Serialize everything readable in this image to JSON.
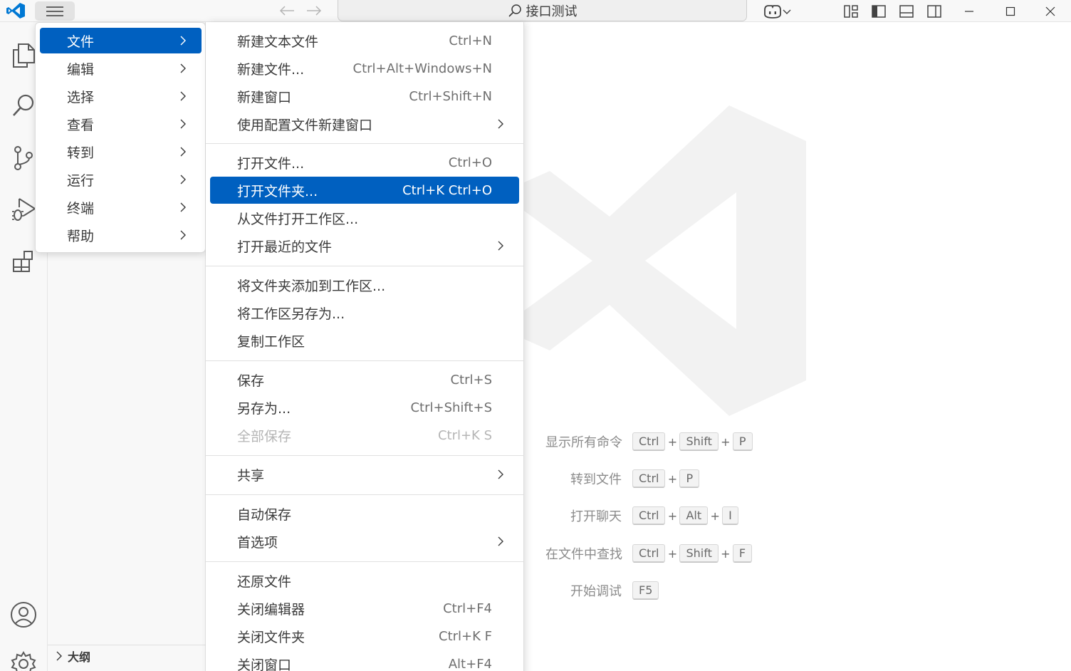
{
  "titlebar": {
    "search_text": "接口测试"
  },
  "main_menu": {
    "items": [
      {
        "label": "文件",
        "active": true
      },
      {
        "label": "编辑"
      },
      {
        "label": "选择"
      },
      {
        "label": "查看"
      },
      {
        "label": "转到"
      },
      {
        "label": "运行"
      },
      {
        "label": "终端"
      },
      {
        "label": "帮助"
      }
    ]
  },
  "file_menu": {
    "items": [
      {
        "label": "新建文本文件",
        "key": "Ctrl+N"
      },
      {
        "label": "新建文件...",
        "key": "Ctrl+Alt+Windows+N"
      },
      {
        "label": "新建窗口",
        "key": "Ctrl+Shift+N"
      },
      {
        "label": "使用配置文件新建窗口",
        "key": ""
      },
      {
        "label": "打开文件...",
        "key": "Ctrl+O"
      },
      {
        "label": "打开文件夹...",
        "key": "Ctrl+K Ctrl+O"
      },
      {
        "label": "从文件打开工作区...",
        "key": ""
      },
      {
        "label": "打开最近的文件",
        "key": ""
      },
      {
        "label": "将文件夹添加到工作区...",
        "key": ""
      },
      {
        "label": "将工作区另存为...",
        "key": ""
      },
      {
        "label": "复制工作区",
        "key": ""
      },
      {
        "label": "保存",
        "key": "Ctrl+S"
      },
      {
        "label": "另存为...",
        "key": "Ctrl+Shift+S"
      },
      {
        "label": "全部保存",
        "key": "Ctrl+K S"
      },
      {
        "label": "共享",
        "key": ""
      },
      {
        "label": "自动保存",
        "key": ""
      },
      {
        "label": "首选项",
        "key": ""
      },
      {
        "label": "还原文件",
        "key": ""
      },
      {
        "label": "关闭编辑器",
        "key": "Ctrl+F4"
      },
      {
        "label": "关闭文件夹",
        "key": "Ctrl+K F"
      },
      {
        "label": "关闭窗口",
        "key": "Alt+F4"
      }
    ]
  },
  "sidebar": {
    "outline_label": "大纲"
  },
  "welcome": {
    "shortcuts": [
      {
        "label": "显示所有命令",
        "keys": [
          "Ctrl",
          "Shift",
          "P"
        ]
      },
      {
        "label": "转到文件",
        "keys": [
          "Ctrl",
          "P"
        ]
      },
      {
        "label": "打开聊天",
        "keys": [
          "Ctrl",
          "Alt",
          "I"
        ]
      },
      {
        "label": "在文件中查找",
        "keys": [
          "Ctrl",
          "Shift",
          "F"
        ]
      },
      {
        "label": "开始调试",
        "keys": [
          "F5"
        ]
      }
    ]
  },
  "colors": {
    "accent": "#0060c0",
    "logo": "#0078d4"
  }
}
